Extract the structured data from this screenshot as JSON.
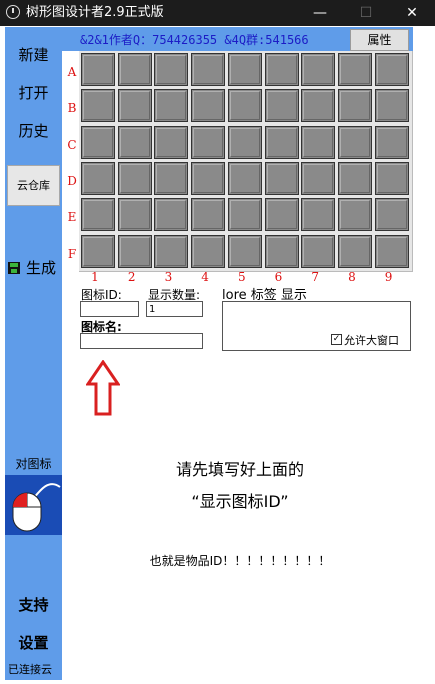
{
  "window": {
    "title": "树形图设计者2.9正式版",
    "minimize": "—",
    "maximize": "☐",
    "close": "✕"
  },
  "sidebar": {
    "new_label": "新建",
    "open_label": "打开",
    "history_label": "历史",
    "cloud_label": "云仓库",
    "generate_label": "生成",
    "pair_icon_label": "对图标",
    "support_label": "支持",
    "settings_label": "设置",
    "status_text": "已连接云"
  },
  "topbar": {
    "info_text": "&2&1作者Q：754426355 &4Q群:541566",
    "properties_label": "属性"
  },
  "grid": {
    "row_labels": [
      "A",
      "B",
      "C",
      "D",
      "E",
      "F"
    ],
    "col_labels": [
      "1",
      "2",
      "3",
      "4",
      "5",
      "6",
      "7",
      "8",
      "9"
    ]
  },
  "form": {
    "icon_id_label": "图标ID:",
    "icon_id_value": "",
    "count_label": "显示数量:",
    "count_value": "1",
    "lore_label": "lore 标签 显示",
    "icon_name_label": "图标名:",
    "icon_name_value": "",
    "allow_big_window_label": "允许大窗口",
    "allow_big_window_checked": true
  },
  "hints": {
    "line1": "请先填写好上面的",
    "line2": "“显示图标ID”",
    "line3": "也就是物品ID！！！！！！！！！"
  },
  "colors": {
    "sidebar_blue": "#5f9ce9",
    "label_red": "#dd1111",
    "arrow_red": "#d92020",
    "info_text_blue": "#1c1cc6"
  }
}
